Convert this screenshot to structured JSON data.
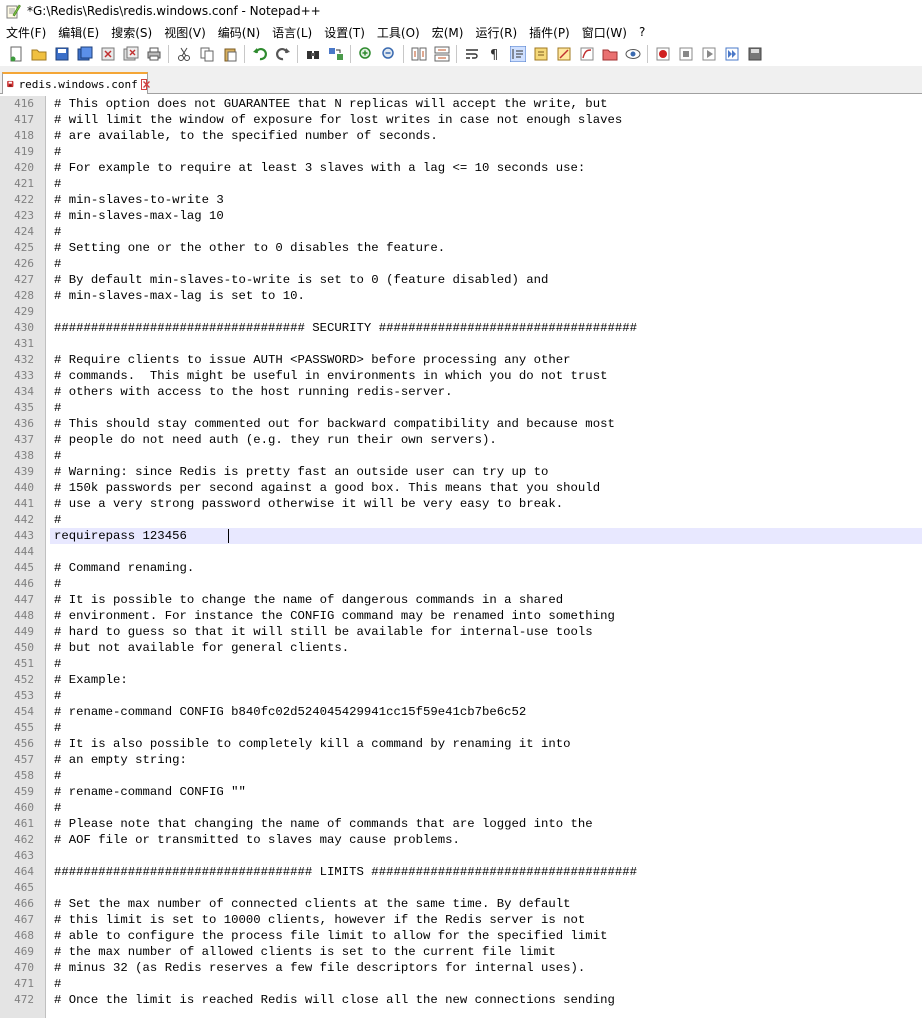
{
  "window": {
    "title": "*G:\\Redis\\Redis\\redis.windows.conf - Notepad++"
  },
  "menu": [
    "文件(F)",
    "编辑(E)",
    "搜索(S)",
    "视图(V)",
    "编码(N)",
    "语言(L)",
    "设置(T)",
    "工具(O)",
    "宏(M)",
    "运行(R)",
    "插件(P)",
    "窗口(W)",
    "?"
  ],
  "toolbar": {
    "buttons": [
      "new-file",
      "open-file",
      "save-file",
      "save-all",
      "close-file",
      "close-all",
      "print",
      "|",
      "cut",
      "copy",
      "paste",
      "|",
      "undo",
      "redo",
      "|",
      "find",
      "replace",
      "|",
      "zoom-in",
      "zoom-out",
      "|",
      "sync-vertical",
      "sync-horizontal",
      "|",
      "word-wrap",
      "show-all-characters",
      "indent-guide",
      "user-defined-language",
      "document-map",
      "function-list",
      "folder-workspace",
      "monitoring",
      "|",
      "record-macro",
      "stop-recording",
      "play-macro",
      "run-macro-multiple",
      "save-macro"
    ]
  },
  "tab": {
    "label": "redis.windows.conf",
    "modified": true
  },
  "editor": {
    "current_line": 443,
    "lines": [
      {
        "n": "416",
        "t": "# This option does not GUARANTEE that N replicas will accept the write, but"
      },
      {
        "n": "417",
        "t": "# will limit the window of exposure for lost writes in case not enough slaves"
      },
      {
        "n": "418",
        "t": "# are available, to the specified number of seconds."
      },
      {
        "n": "419",
        "t": "#"
      },
      {
        "n": "420",
        "t": "# For example to require at least 3 slaves with a lag <= 10 seconds use:"
      },
      {
        "n": "421",
        "t": "#"
      },
      {
        "n": "422",
        "t": "# min-slaves-to-write 3"
      },
      {
        "n": "423",
        "t": "# min-slaves-max-lag 10"
      },
      {
        "n": "424",
        "t": "#"
      },
      {
        "n": "425",
        "t": "# Setting one or the other to 0 disables the feature."
      },
      {
        "n": "426",
        "t": "#"
      },
      {
        "n": "427",
        "t": "# By default min-slaves-to-write is set to 0 (feature disabled) and"
      },
      {
        "n": "428",
        "t": "# min-slaves-max-lag is set to 10."
      },
      {
        "n": "429",
        "t": ""
      },
      {
        "n": "430",
        "t": "################################## SECURITY ###################################"
      },
      {
        "n": "431",
        "t": ""
      },
      {
        "n": "432",
        "t": "# Require clients to issue AUTH <PASSWORD> before processing any other"
      },
      {
        "n": "433",
        "t": "# commands.  This might be useful in environments in which you do not trust"
      },
      {
        "n": "434",
        "t": "# others with access to the host running redis-server."
      },
      {
        "n": "435",
        "t": "#"
      },
      {
        "n": "436",
        "t": "# This should stay commented out for backward compatibility and because most"
      },
      {
        "n": "437",
        "t": "# people do not need auth (e.g. they run their own servers)."
      },
      {
        "n": "438",
        "t": "#"
      },
      {
        "n": "439",
        "t": "# Warning: since Redis is pretty fast an outside user can try up to"
      },
      {
        "n": "440",
        "t": "# 150k passwords per second against a good box. This means that you should"
      },
      {
        "n": "441",
        "t": "# use a very strong password otherwise it will be very easy to break."
      },
      {
        "n": "442",
        "t": "#"
      },
      {
        "n": "443",
        "t": "requirepass 123456"
      },
      {
        "n": "444",
        "t": ""
      },
      {
        "n": "445",
        "t": "# Command renaming."
      },
      {
        "n": "446",
        "t": "#"
      },
      {
        "n": "447",
        "t": "# It is possible to change the name of dangerous commands in a shared"
      },
      {
        "n": "448",
        "t": "# environment. For instance the CONFIG command may be renamed into something"
      },
      {
        "n": "449",
        "t": "# hard to guess so that it will still be available for internal-use tools"
      },
      {
        "n": "450",
        "t": "# but not available for general clients."
      },
      {
        "n": "451",
        "t": "#"
      },
      {
        "n": "452",
        "t": "# Example:"
      },
      {
        "n": "453",
        "t": "#"
      },
      {
        "n": "454",
        "t": "# rename-command CONFIG b840fc02d524045429941cc15f59e41cb7be6c52"
      },
      {
        "n": "455",
        "t": "#"
      },
      {
        "n": "456",
        "t": "# It is also possible to completely kill a command by renaming it into"
      },
      {
        "n": "457",
        "t": "# an empty string:"
      },
      {
        "n": "458",
        "t": "#"
      },
      {
        "n": "459",
        "t": "# rename-command CONFIG \"\""
      },
      {
        "n": "460",
        "t": "#"
      },
      {
        "n": "461",
        "t": "# Please note that changing the name of commands that are logged into the"
      },
      {
        "n": "462",
        "t": "# AOF file or transmitted to slaves may cause problems."
      },
      {
        "n": "463",
        "t": ""
      },
      {
        "n": "464",
        "t": "################################### LIMITS ####################################"
      },
      {
        "n": "465",
        "t": ""
      },
      {
        "n": "466",
        "t": "# Set the max number of connected clients at the same time. By default"
      },
      {
        "n": "467",
        "t": "# this limit is set to 10000 clients, however if the Redis server is not"
      },
      {
        "n": "468",
        "t": "# able to configure the process file limit to allow for the specified limit"
      },
      {
        "n": "469",
        "t": "# the max number of allowed clients is set to the current file limit"
      },
      {
        "n": "470",
        "t": "# minus 32 (as Redis reserves a few file descriptors for internal uses)."
      },
      {
        "n": "471",
        "t": "#"
      },
      {
        "n": "472",
        "t": "# Once the limit is reached Redis will close all the new connections sending"
      }
    ]
  }
}
